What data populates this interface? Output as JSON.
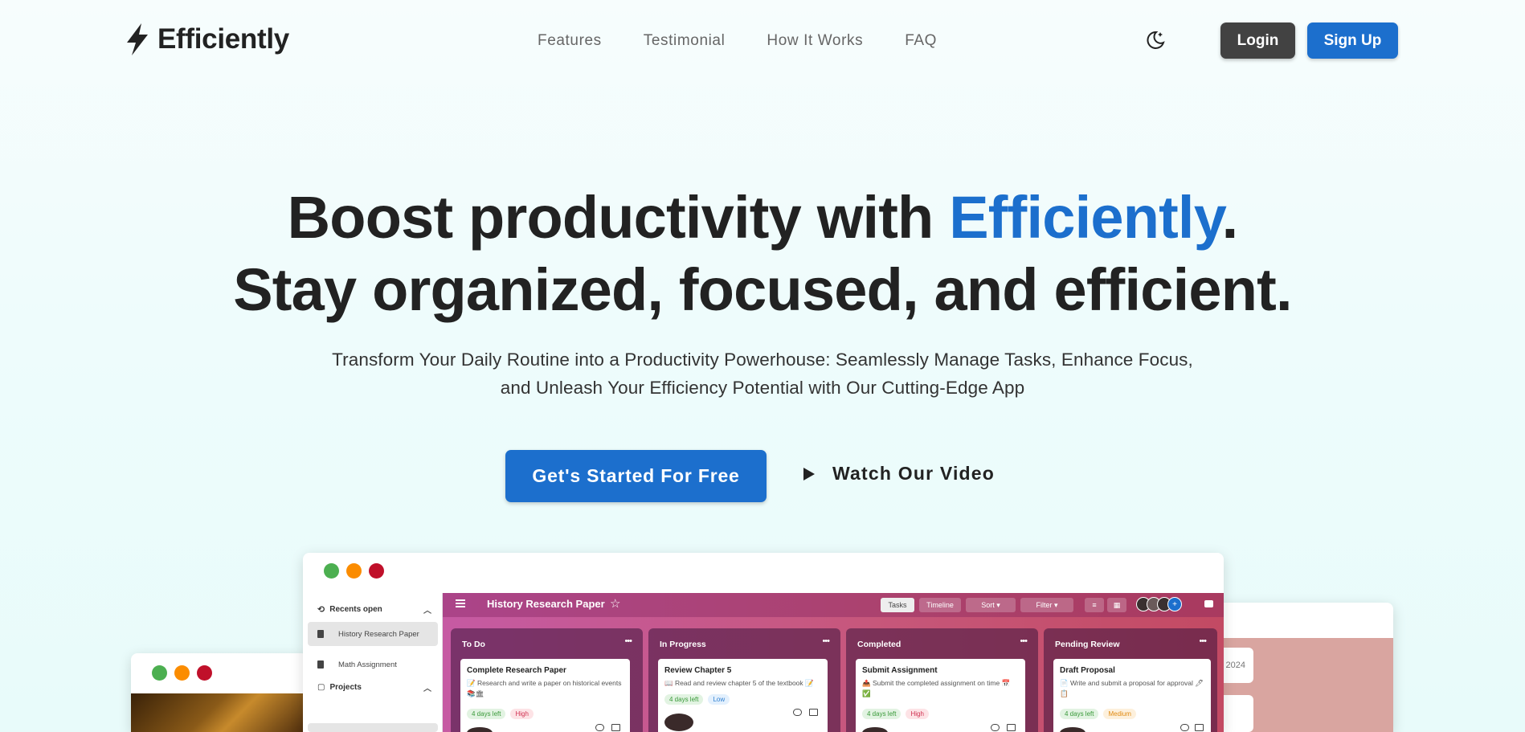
{
  "brand": {
    "name": "Efficiently"
  },
  "nav": {
    "links": [
      "Features",
      "Testimonial",
      "How It Works",
      "FAQ"
    ],
    "login": "Login",
    "signup": "Sign Up"
  },
  "hero": {
    "line1_pre": "Boost productivity with ",
    "line1_accent": "Efficiently",
    "line1_post": ".",
    "line2": "Stay organized, focused, and efficient.",
    "sub1": "Transform Your Daily Routine into a Productivity Powerhouse: Seamlessly Manage Tasks, Enhance Focus,",
    "sub2": "and Unleash Your Efficiency Potential with Our Cutting-Edge App",
    "cta": "Get's Started For Free",
    "video": "Watch Our Video"
  },
  "colors": {
    "accent": "#1c6fcd",
    "dark_button": "#424242"
  },
  "preview": {
    "sidebar": {
      "recents": "Recents open",
      "items": [
        "History Research Paper",
        "Math Assignment"
      ],
      "projects": "Projects"
    },
    "board": {
      "title": "History Research Paper",
      "toolbar": [
        "Tasks",
        "Timeline",
        "Sort",
        "Filter"
      ],
      "columns": [
        {
          "title": "To Do",
          "card_title": "Complete Research Paper",
          "card_desc": "📝 Research and write a paper on historical events 📚🏛",
          "tags": [
            "4 days left",
            "High"
          ]
        },
        {
          "title": "In Progress",
          "card_title": "Review Chapter 5",
          "card_desc": "📖 Read and review chapter 5 of the textbook 📝",
          "tags": [
            "4 days left",
            "Low"
          ]
        },
        {
          "title": "Completed",
          "card_title": "Submit Assignment",
          "card_desc": "📤 Submit the completed assignment on time 📅 ✅",
          "tags": [
            "4 days left",
            "High"
          ]
        },
        {
          "title": "Pending Review",
          "card_title": "Draft Proposal",
          "card_desc": "📄 Write and submit a proposal for approval 🖊 📋",
          "tags": [
            "4 days left",
            "Medium"
          ]
        }
      ]
    },
    "right_window": {
      "date_fragment": "2024"
    }
  }
}
